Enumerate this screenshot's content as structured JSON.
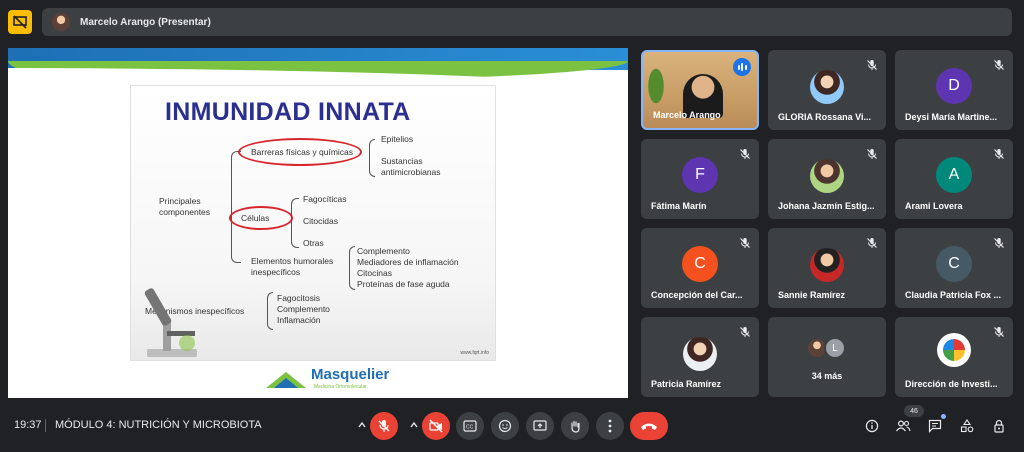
{
  "presenter_bar": {
    "name": "Marcelo Arango (Presentar)"
  },
  "slide": {
    "title": "INMUNIDAD INNATA",
    "principales": "Principales\ncomponentes",
    "barreras": "Barreras físicas y químicas",
    "epitelios": "Epitelios",
    "sustancias": "Sustancias\nantimicrobianas",
    "celulas": "Células",
    "fagociticas": "Fagocíticas",
    "citocidas": "Citocidas",
    "otras": "Otras",
    "elementos": "Elementos humorales\ninespecíficos",
    "humorales_list": "Complemento\nMediadores de inflamación\nCitocinas\nProteínas de fase aguda",
    "mecanismos": "Mecanismos inespecíficos",
    "mecanismos_list": "Fagocitosis\nComplemento\nInflamación",
    "url": "www.fqrt.info",
    "logo": "Masquelier",
    "logo_sub": "Medicina Ortomolecular"
  },
  "participants": [
    {
      "name": "Marcelo Arango",
      "type": "self"
    },
    {
      "name": "GLORIA Rossana Vi...",
      "type": "photo",
      "muted": true
    },
    {
      "name": "Deysi María Martine...",
      "type": "letter",
      "letter": "D",
      "color": "#5e35b1",
      "muted": true
    },
    {
      "name": "Fátima Marín",
      "type": "letter",
      "letter": "F",
      "color": "#5e35b1",
      "muted": true
    },
    {
      "name": "Johana Jazmín Estig...",
      "type": "photo",
      "muted": true
    },
    {
      "name": "Arami Lovera",
      "type": "letter",
      "letter": "A",
      "color": "#00897b",
      "muted": true
    },
    {
      "name": "Concepción del Car...",
      "type": "letter",
      "letter": "C",
      "color": "#f4511e",
      "muted": true
    },
    {
      "name": "Sannie Ramírez",
      "type": "photo",
      "muted": true
    },
    {
      "name": "Claudia Patricia Fox ...",
      "type": "letter",
      "letter": "C",
      "color": "#455a64",
      "muted": true
    },
    {
      "name": "Patricia Ramírez",
      "type": "photo",
      "muted": true
    },
    {
      "name": "34 más",
      "type": "more",
      "letter": "L"
    },
    {
      "name": "Dirección de Investi...",
      "type": "logo",
      "muted": true
    }
  ],
  "bottom": {
    "time": "19:37",
    "meeting_title": "MÓDULO 4: NUTRICIÓN Y MICROBIOTA",
    "participant_count": "46"
  },
  "colors": {
    "background": "#202124",
    "tile": "#3c4043",
    "danger": "#ea4335",
    "accent": "#8ab4f8"
  }
}
